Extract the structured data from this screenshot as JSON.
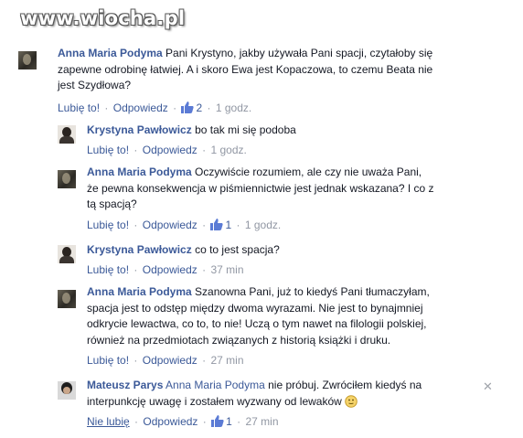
{
  "watermark": "www.wiocha.pl",
  "comments": [
    {
      "author": "Anna Maria Podyma",
      "lines": [
        "Pani Krystyno, jakby używała Pani spacji, czytałoby się",
        "zapewne odrobinę łatwiej. A i skoro Ewa jest Kopaczowa, to czemu Beata nie",
        "jest Szydłowa?"
      ],
      "like_label": "Lubię to!",
      "reply_label": "Odpowiedz",
      "likes": "2",
      "time": "1 godz."
    },
    {
      "author": "Krystyna Pawłowicz",
      "lines": [
        "bo tak mi się podoba"
      ],
      "like_label": "Lubię to!",
      "reply_label": "Odpowiedz",
      "time": "1 godz."
    },
    {
      "author": "Anna Maria Podyma",
      "lines": [
        "Oczywiście rozumiem, ale czy nie uważa Pani,",
        "że pewna konsekwencja w piśmiennictwie jest jednak wskazana? I co z",
        "tą spacją?"
      ],
      "like_label": "Lubię to!",
      "reply_label": "Odpowiedz",
      "likes": "1",
      "time": "1 godz."
    },
    {
      "author": "Krystyna Pawłowicz",
      "lines": [
        "co to jest spacja?"
      ],
      "like_label": "Lubię to!",
      "reply_label": "Odpowiedz",
      "time": "37 min"
    },
    {
      "author": "Anna Maria Podyma",
      "lines": [
        "Szanowna Pani, już to kiedyś Pani tłumaczyłam,",
        "spacja jest to odstęp między dwoma wyrazami. Nie jest to bynajmniej",
        "odkrycie lewactwa, co to, to nie! Uczą o tym nawet na filologii polskiej,",
        "również na przedmiotach związanych z historią książki i druku."
      ],
      "like_label": "Lubię to!",
      "reply_label": "Odpowiedz",
      "time": "27 min"
    },
    {
      "author": "Mateusz Parys",
      "mention": "Anna Maria Podyma",
      "lines": [
        "nie próbuj. Zwróciłem kiedyś na",
        "interpunkcję uwagę i zostałem wyzwany od lewaków"
      ],
      "like_label": "Nie lubię",
      "reply_label": "Odpowiedz",
      "likes": "1",
      "time": "27 min"
    }
  ],
  "icons": {
    "like": "thumbs-up-icon",
    "emoji": "smile-emoji-icon",
    "close": "close-icon"
  },
  "colors": {
    "link": "#3b5998",
    "meta": "#9197a3",
    "text": "#141823"
  }
}
